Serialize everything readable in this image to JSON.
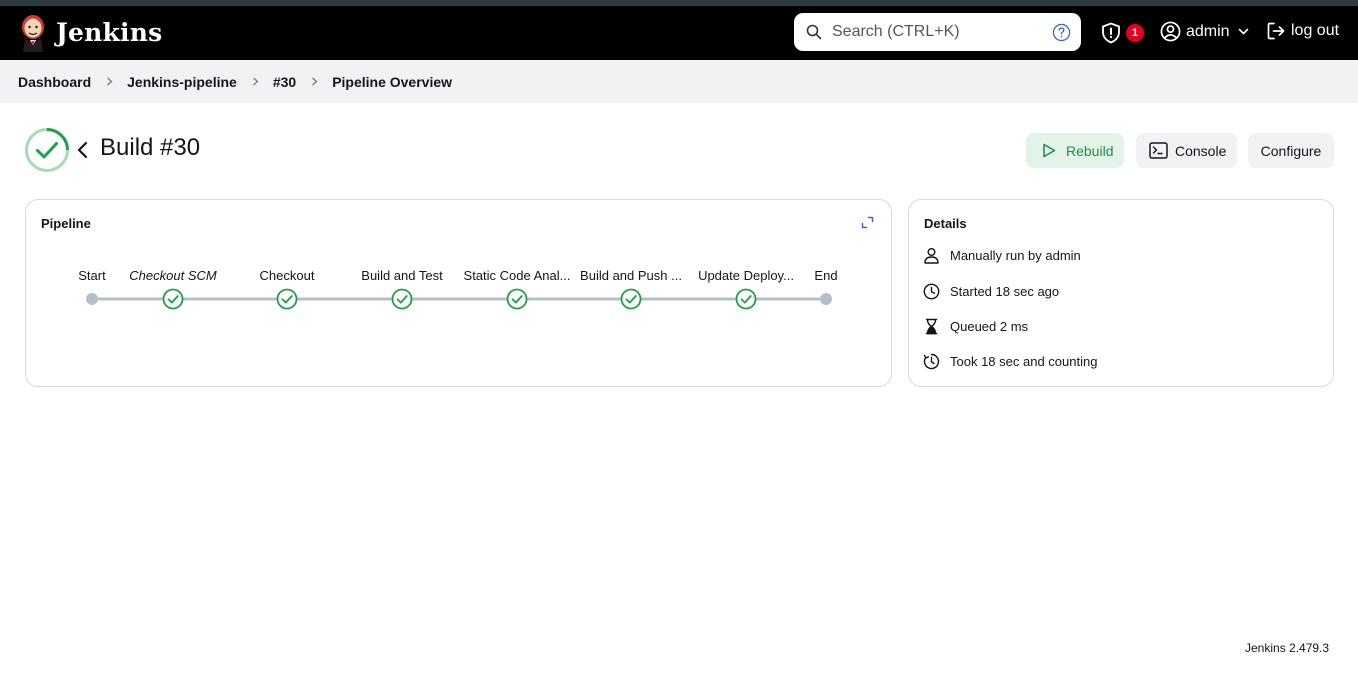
{
  "header": {
    "app_name": "Jenkins",
    "search_placeholder": "Search (CTRL+K)",
    "security_badge_count": "1",
    "user_name": "admin",
    "logout_label": "log out"
  },
  "breadcrumbs": [
    "Dashboard",
    "Jenkins-pipeline",
    "#30",
    "Pipeline Overview"
  ],
  "build": {
    "title": "Build #30",
    "status": "success",
    "buttons": {
      "rebuild": "Rebuild",
      "console": "Console",
      "configure": "Configure"
    }
  },
  "pipeline": {
    "title": "Pipeline",
    "stages": [
      {
        "label": "Start",
        "kind": "start"
      },
      {
        "label": "Checkout SCM",
        "kind": "success",
        "italic": true
      },
      {
        "label": "Checkout",
        "kind": "success"
      },
      {
        "label": "Build and Test",
        "kind": "success"
      },
      {
        "label": "Static Code Anal...",
        "kind": "success"
      },
      {
        "label": "Build and Push ...",
        "kind": "success"
      },
      {
        "label": "Update Deploy...",
        "kind": "success"
      },
      {
        "label": "End",
        "kind": "end"
      }
    ]
  },
  "details": {
    "title": "Details",
    "items": [
      {
        "icon": "user-icon",
        "text": "Manually run by admin"
      },
      {
        "icon": "clock-icon",
        "text": "Started 18 sec ago"
      },
      {
        "icon": "hourglass-icon",
        "text": "Queued 2 ms"
      },
      {
        "icon": "timer-icon",
        "text": "Took 18 sec and counting"
      }
    ]
  },
  "footer": {
    "version": "Jenkins 2.479.3"
  },
  "colors": {
    "success": "#1e9f48",
    "header_bg": "#000000",
    "breadcrumb_bg": "#f2f2f4",
    "badge": "#e6001f",
    "connector": "#b3c0cc"
  }
}
